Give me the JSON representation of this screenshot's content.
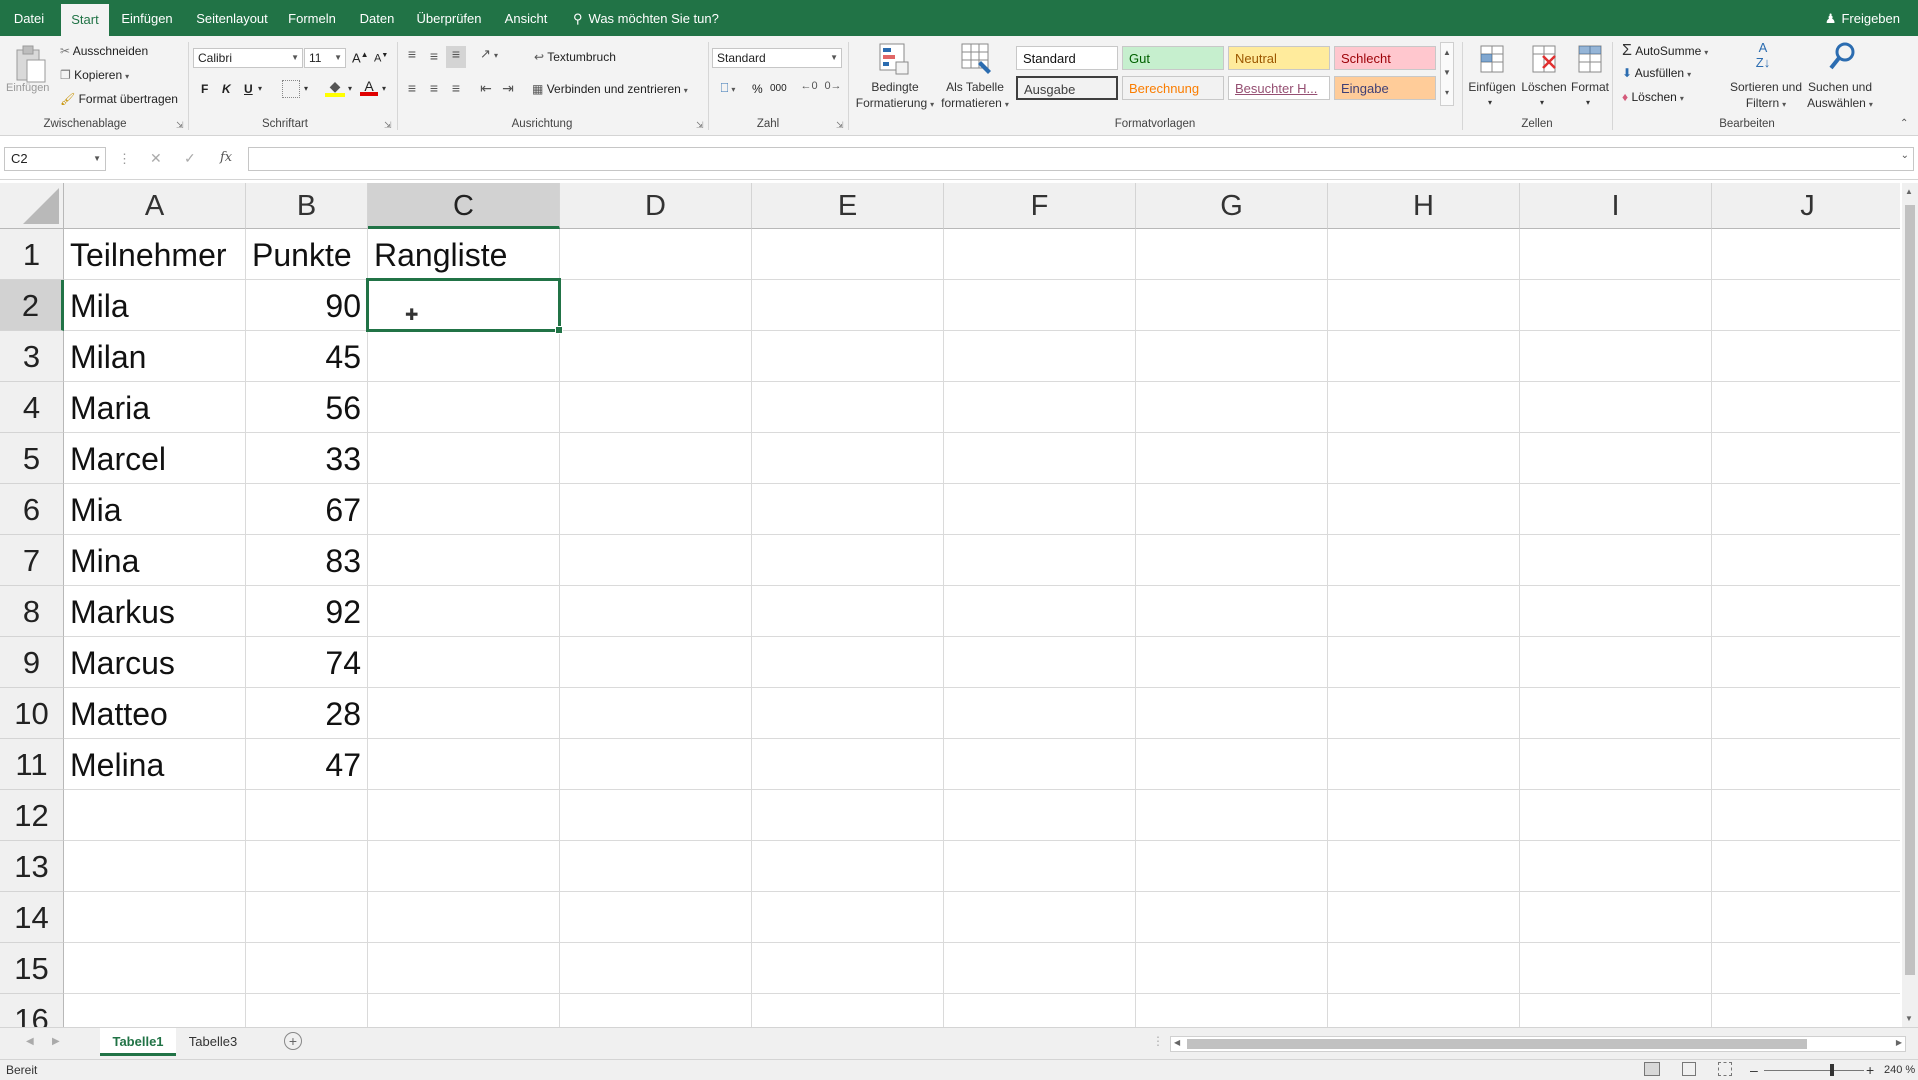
{
  "tabs": [
    {
      "label": "Datei",
      "active": false
    },
    {
      "label": "Start",
      "active": true
    },
    {
      "label": "Einfügen",
      "active": false
    },
    {
      "label": "Seitenlayout",
      "active": false
    },
    {
      "label": "Formeln",
      "active": false
    },
    {
      "label": "Daten",
      "active": false
    },
    {
      "label": "Überprüfen",
      "active": false
    },
    {
      "label": "Ansicht",
      "active": false
    }
  ],
  "tell_me": "Was möchten Sie tun?",
  "share": "Freigeben",
  "ribbon": {
    "clipboard": {
      "paste": "Einfügen",
      "cut": "Ausschneiden",
      "copy": "Kopieren",
      "format_painter": "Format übertragen",
      "label": "Zwischenablage"
    },
    "font": {
      "name": "Calibri",
      "size": "11",
      "bold": "F",
      "italic": "K",
      "underline": "U",
      "label": "Schriftart"
    },
    "alignment": {
      "wrap": "Textumbruch",
      "merge": "Verbinden und zentrieren",
      "label": "Ausrichtung"
    },
    "number": {
      "format": "Standard",
      "percent": "%",
      "thousands": "000",
      "label": "Zahl"
    },
    "styles": {
      "conditional_line1": "Bedingte",
      "conditional_line2": "Formatierung",
      "as_table_line1": "Als Tabelle",
      "as_table_line2": "formatieren",
      "cells": [
        {
          "label": "Standard",
          "bg": "#ffffff",
          "color": "#111111"
        },
        {
          "label": "Gut",
          "bg": "#c6efce",
          "color": "#006100"
        },
        {
          "label": "Neutral",
          "bg": "#ffeb9c",
          "color": "#9c5700"
        },
        {
          "label": "Schlecht",
          "bg": "#ffc7ce",
          "color": "#9c0006"
        },
        {
          "label": "Ausgabe",
          "bg": "#f2f2f2",
          "color": "#3f3f3f"
        },
        {
          "label": "Berechnung",
          "bg": "#f2f2f2",
          "color": "#fa7d00"
        },
        {
          "label": "Besuchter H...",
          "bg": "#ffffff",
          "color": "#954f72"
        },
        {
          "label": "Eingabe",
          "bg": "#ffcc99",
          "color": "#3f3f76"
        }
      ],
      "label": "Formatvorlagen"
    },
    "cells": {
      "insert": "Einfügen",
      "delete": "Löschen",
      "format": "Format",
      "label": "Zellen"
    },
    "editing": {
      "autosum": "AutoSumme",
      "fill": "Ausfüllen",
      "clear": "Löschen",
      "sort_line1": "Sortieren und",
      "sort_line2": "Filtern",
      "find_line1": "Suchen und",
      "find_line2": "Auswählen",
      "label": "Bearbeiten"
    }
  },
  "formula_bar": {
    "name_box": "C2",
    "fx": "fx",
    "value": ""
  },
  "columns": [
    "A",
    "B",
    "C",
    "D",
    "E",
    "F",
    "G",
    "H",
    "I",
    "J"
  ],
  "rows": [
    "1",
    "2",
    "3",
    "4",
    "5",
    "6",
    "7",
    "8",
    "9",
    "10",
    "11",
    "12",
    "13",
    "14",
    "15",
    "16"
  ],
  "cells": {
    "A": [
      "Teilnehmer",
      "Mila",
      "Milan",
      "Maria",
      "Marcel",
      "Mia",
      "Mina",
      "Markus",
      "Marcus",
      "Matteo",
      "Melina"
    ],
    "B": [
      "Punkte",
      "90",
      "45",
      "56",
      "33",
      "67",
      "83",
      "92",
      "74",
      "28",
      "47"
    ],
    "C": [
      "Rangliste"
    ]
  },
  "selected_cell": {
    "column": "C",
    "row": "2"
  },
  "sheets": [
    {
      "label": "Tabelle1",
      "active": true
    },
    {
      "label": "Tabelle3",
      "active": false
    }
  ],
  "status": {
    "ready": "Bereit",
    "zoom": "240 %"
  },
  "colors": {
    "accent": "#217346"
  }
}
